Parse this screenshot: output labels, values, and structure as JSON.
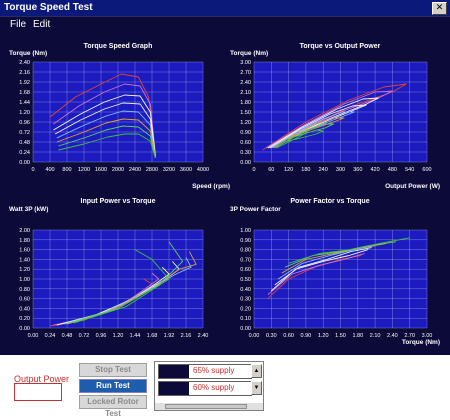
{
  "window": {
    "title": "Torque Speed Test",
    "close_glyph": "✕"
  },
  "menu": [
    {
      "label": "File"
    },
    {
      "label": "Edit"
    }
  ],
  "colors": {
    "window_bg": "#0c0a38",
    "plot_bg": "#1b1bbf",
    "grid": "#c0c8f0",
    "series": [
      "#e04040",
      "#d070d0",
      "#f8f8f8",
      "#f0f0f0",
      "#80c0ff",
      "#e0a030",
      "#60d060",
      "#40c040"
    ]
  },
  "charts": [
    {
      "id": "torque-speed",
      "title": "Torque Speed Graph",
      "ylabel": "Torque (Nm)",
      "xlabel": "Speed (rpm)",
      "xticks": [
        "0",
        "400",
        "800",
        "1200",
        "1600",
        "2000",
        "2400",
        "2800",
        "3200",
        "3600",
        "4000"
      ],
      "yticks": [
        "0.00",
        "0.24",
        "0.48",
        "0.72",
        "0.96",
        "1.20",
        "1.44",
        "1.68",
        "1.92",
        "2.16",
        "2.40"
      ]
    },
    {
      "id": "torque-vs-output-power",
      "title": "Torque vs Output Power",
      "ylabel": "Torque (Nm)",
      "xlabel": "Output Power (W)",
      "xticks": [
        "0",
        "60",
        "120",
        "180",
        "240",
        "300",
        "360",
        "420",
        "480",
        "540",
        "600"
      ],
      "yticks": [
        "0.00",
        "0.30",
        "0.60",
        "0.90",
        "1.20",
        "1.50",
        "1.80",
        "2.10",
        "2.40",
        "2.70",
        "3.00"
      ]
    },
    {
      "id": "input-power-vs-torque",
      "title": "Input Power vs Torque",
      "ylabel": "Watt 3P (kW)",
      "xlabel": "",
      "xticks": [
        "0.00",
        "0.24",
        "0.48",
        "0.72",
        "0.96",
        "1.20",
        "1.44",
        "1.68",
        "1.92",
        "2.16",
        "2.40"
      ],
      "yticks": [
        "0.00",
        "0.20",
        "0.40",
        "0.60",
        "0.80",
        "1.00",
        "1.20",
        "1.40",
        "1.60",
        "1.80",
        "2.00"
      ]
    },
    {
      "id": "power-factor-vs-torque",
      "title": "Power Factor vs Torque",
      "ylabel": "3P Power Factor",
      "xlabel": "Torque (Nm)",
      "xticks": [
        "0.00",
        "0.30",
        "0.60",
        "0.90",
        "1.20",
        "1.50",
        "1.80",
        "2.10",
        "2.40",
        "2.70",
        "3.00"
      ],
      "yticks": [
        "0.00",
        "0.10",
        "0.20",
        "0.30",
        "0.40",
        "0.50",
        "0.60",
        "0.70",
        "0.80",
        "0.90",
        "1.00"
      ]
    }
  ],
  "controls": {
    "output_power_label": "Output Power",
    "stop_test": "Stop Test",
    "run_test": "Run Test",
    "locked_rotor_test": "Locked Rotor Test"
  },
  "supply_list": [
    {
      "label": "65% supply"
    },
    {
      "label": "60% supply"
    }
  ]
}
